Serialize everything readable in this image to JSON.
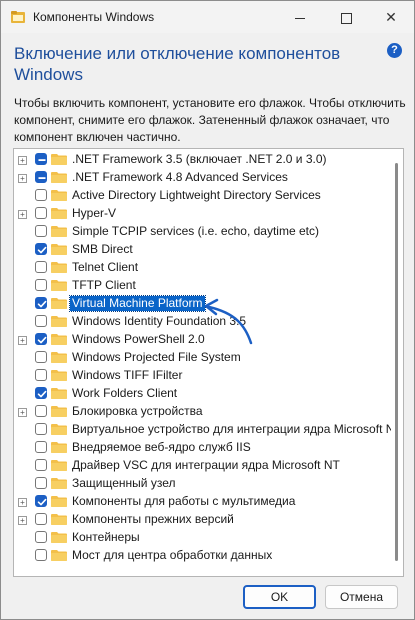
{
  "window": {
    "title": "Компоненты Windows",
    "help": "?"
  },
  "heading": "Включение или отключение компонентов Windows",
  "description": "Чтобы включить компонент, установите его флажок. Чтобы отключить компонент, снимите его флажок. Затененный флажок означает, что компонент включен частично.",
  "features": [
    {
      "label": ".NET Framework 3.5 (включает .NET 2.0 и 3.0)",
      "expandable": true,
      "state": "partial"
    },
    {
      "label": ".NET Framework 4.8 Advanced Services",
      "expandable": true,
      "state": "partial"
    },
    {
      "label": "Active Directory Lightweight Directory Services",
      "expandable": false,
      "state": "unchecked"
    },
    {
      "label": "Hyper-V",
      "expandable": true,
      "state": "unchecked"
    },
    {
      "label": "Simple TCPIP services (i.e. echo, daytime etc)",
      "expandable": false,
      "state": "unchecked"
    },
    {
      "label": "SMB Direct",
      "expandable": false,
      "state": "checked"
    },
    {
      "label": "Telnet Client",
      "expandable": false,
      "state": "unchecked"
    },
    {
      "label": "TFTP Client",
      "expandable": false,
      "state": "unchecked"
    },
    {
      "label": "Virtual Machine Platform",
      "expandable": false,
      "state": "checked",
      "selected": true
    },
    {
      "label": "Windows Identity Foundation 3.5",
      "expandable": false,
      "state": "unchecked"
    },
    {
      "label": "Windows PowerShell 2.0",
      "expandable": true,
      "state": "checked"
    },
    {
      "label": "Windows Projected File System",
      "expandable": false,
      "state": "unchecked"
    },
    {
      "label": "Windows TIFF IFilter",
      "expandable": false,
      "state": "unchecked"
    },
    {
      "label": "Work Folders Client",
      "expandable": false,
      "state": "checked"
    },
    {
      "label": "Блокировка устройства",
      "expandable": true,
      "state": "unchecked"
    },
    {
      "label": "Виртуальное устройство для интеграции ядра Microsoft N",
      "expandable": false,
      "state": "unchecked"
    },
    {
      "label": "Внедряемое веб-ядро служб IIS",
      "expandable": false,
      "state": "unchecked"
    },
    {
      "label": "Драйвер VSC для интеграции ядра Microsoft NT",
      "expandable": false,
      "state": "unchecked"
    },
    {
      "label": "Защищенный узел",
      "expandable": false,
      "state": "unchecked"
    },
    {
      "label": "Компоненты для работы с мультимедиа",
      "expandable": true,
      "state": "checked"
    },
    {
      "label": "Компоненты прежних версий",
      "expandable": true,
      "state": "unchecked"
    },
    {
      "label": "Контейнеры",
      "expandable": false,
      "state": "unchecked"
    },
    {
      "label": "Мост для центра обработки данных",
      "expandable": false,
      "state": "unchecked"
    }
  ],
  "buttons": {
    "ok": "OK",
    "cancel": "Отмена"
  },
  "colors": {
    "accent": "#1c5fc4",
    "heading": "#1f4f9c",
    "selection": "#0a64c8",
    "folder": "#f3c04a"
  }
}
